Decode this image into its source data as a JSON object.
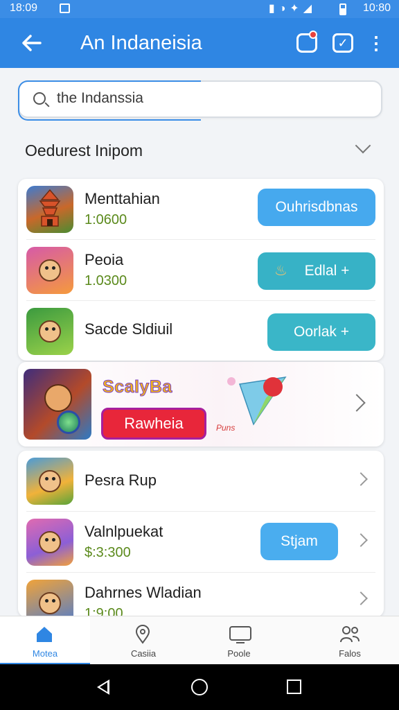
{
  "status_bar": {
    "time": "18:09",
    "clock": "10:80"
  },
  "app_bar": {
    "title": "An Indaneisia"
  },
  "search": {
    "value": "the Indanssia"
  },
  "section": {
    "title": "Oedurest Inipom"
  },
  "card_a": {
    "items": [
      {
        "name": "Menttahian",
        "price": "1:0600",
        "action": "Ouhrisdbnas",
        "action_color": "#46a9ee"
      },
      {
        "name": "Peoia",
        "price": "1.0300",
        "action": "Edlal +",
        "action_color": "#37b2c6"
      },
      {
        "name": "Sacde Sldiuil",
        "price": "",
        "action": "Oorlak +",
        "action_color": "#3ab6c8"
      }
    ]
  },
  "promo": {
    "title": "ScalyBa",
    "button": "Rawheia",
    "art_caption": "Puns"
  },
  "card_c": {
    "items": [
      {
        "name": "Pesra Rup",
        "price": "",
        "action": ""
      },
      {
        "name": "Valnlpuekat",
        "price": "$:3:300",
        "action": "Stjam",
        "action_color": "#4aadef"
      },
      {
        "name": "Dahrnes Wladian",
        "price": "1:9:00",
        "action": ""
      }
    ]
  },
  "bottom_nav": {
    "items": [
      {
        "label": "Motea",
        "icon": "home-icon"
      },
      {
        "label": "Casiia",
        "icon": "map-pin-icon"
      },
      {
        "label": "Poole",
        "icon": "tv-icon"
      },
      {
        "label": "Falos",
        "icon": "people-icon"
      }
    ]
  },
  "colors": {
    "primary": "#2f86e3",
    "price": "#5b8a1c",
    "promo_red": "#e8263a"
  }
}
